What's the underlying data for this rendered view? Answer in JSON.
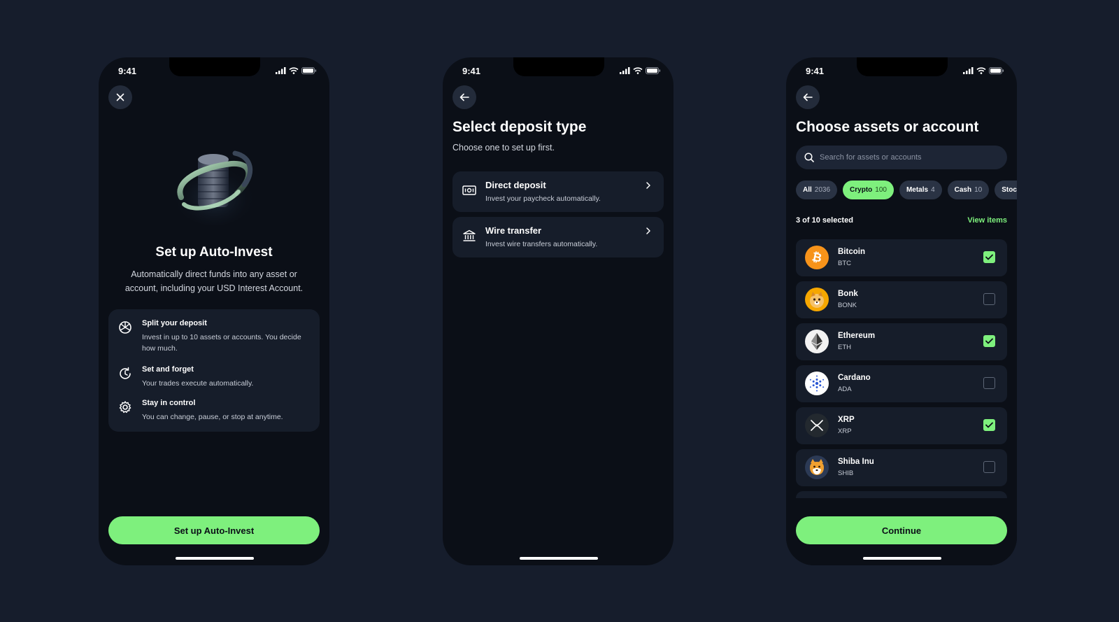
{
  "colors": {
    "background": "#161d2c",
    "phone": "#0b0f17",
    "card": "#161d2a",
    "accent": "#7ef07d"
  },
  "status_bar": {
    "time": "9:41"
  },
  "screen1": {
    "close_icon": "close-icon",
    "title": "Set up Auto-Invest",
    "subtitle": "Automatically direct funds into any asset or account, including your USD Interest Account.",
    "features": [
      {
        "icon": "split-icon",
        "title": "Split your deposit",
        "description": "Invest in up to 10 assets or accounts. You decide how much."
      },
      {
        "icon": "clock-refresh-icon",
        "title": "Set and forget",
        "description": "Your trades execute automatically."
      },
      {
        "icon": "gear-icon",
        "title": "Stay in control",
        "description": "You can change, pause, or stop at anytime."
      }
    ],
    "button_label": "Set up Auto-Invest"
  },
  "screen2": {
    "back_icon": "back-arrow-icon",
    "title": "Select deposit type",
    "subtitle": "Choose one to set up first.",
    "options": [
      {
        "icon": "paycheck-icon",
        "title": "Direct deposit",
        "description": "Invest your paycheck automatically."
      },
      {
        "icon": "bank-icon",
        "title": "Wire transfer",
        "description": "Invest wire transfers automatically."
      }
    ]
  },
  "screen3": {
    "back_icon": "back-arrow-icon",
    "title": "Choose assets or account",
    "search_placeholder": "Search for assets or accounts",
    "chips": [
      {
        "label": "All",
        "count": "2036",
        "active": false
      },
      {
        "label": "Crypto",
        "count": "100",
        "active": true
      },
      {
        "label": "Metals",
        "count": "4",
        "active": false
      },
      {
        "label": "Cash",
        "count": "10",
        "active": false
      },
      {
        "label": "Stocks",
        "count": "",
        "active": false
      }
    ],
    "selected_count": "3 of 10 selected",
    "view_items": "View items",
    "assets": [
      {
        "name": "Bitcoin",
        "symbol": "BTC",
        "logo": "bitcoin-icon",
        "checked": true
      },
      {
        "name": "Bonk",
        "symbol": "BONK",
        "logo": "bonk-icon",
        "checked": false
      },
      {
        "name": "Ethereum",
        "symbol": "ETH",
        "logo": "ethereum-icon",
        "checked": true
      },
      {
        "name": "Cardano",
        "symbol": "ADA",
        "logo": "cardano-icon",
        "checked": false
      },
      {
        "name": "XRP",
        "symbol": "XRP",
        "logo": "xrp-icon",
        "checked": true
      },
      {
        "name": "Shiba Inu",
        "symbol": "SHIB",
        "logo": "shiba-icon",
        "checked": false
      }
    ],
    "button_label": "Continue"
  }
}
